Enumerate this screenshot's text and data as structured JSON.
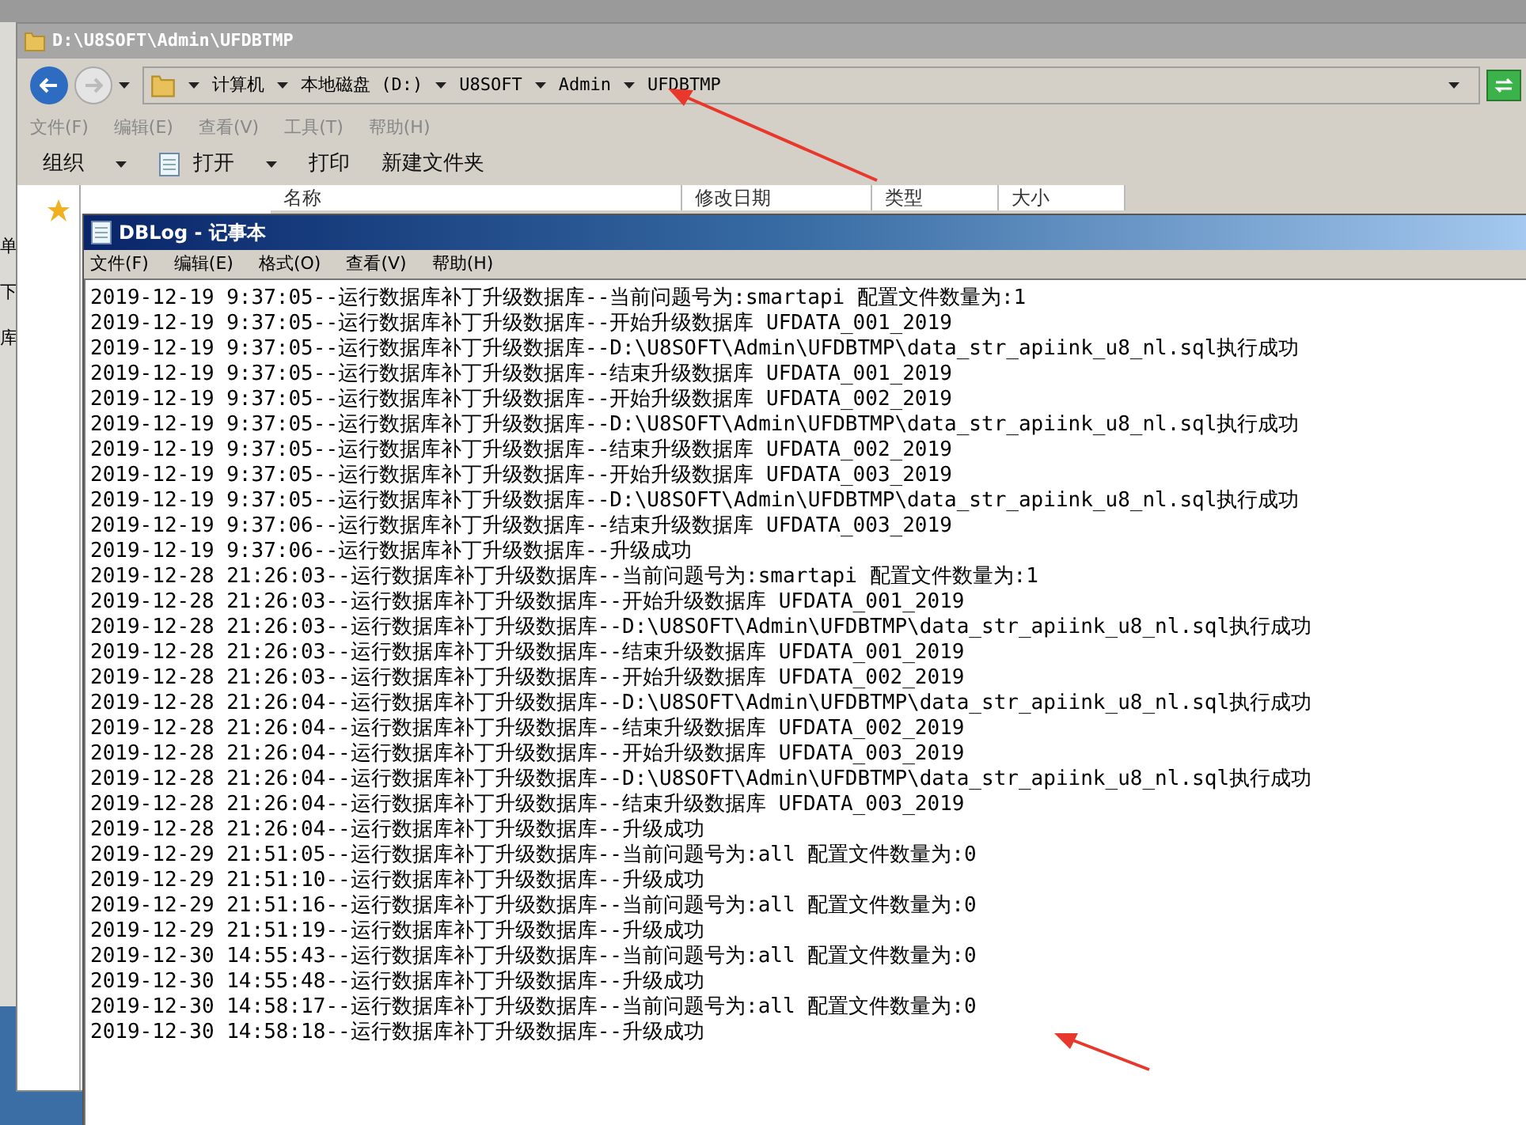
{
  "left_fragments": [
    "单",
    "下",
    "库"
  ],
  "explorer": {
    "title": "D:\\U8SOFT\\Admin\\UFDBTMP",
    "breadcrumb": [
      "计算机",
      "本地磁盘 (D:)",
      "U8SOFT",
      "Admin",
      "UFDBTMP"
    ],
    "menu": [
      "文件(F)",
      "编辑(E)",
      "查看(V)",
      "工具(T)",
      "帮助(H)"
    ],
    "toolbar": [
      {
        "label": "组织",
        "kind": "dropdown"
      },
      {
        "label": "打开",
        "kind": "icon-dropdown"
      },
      {
        "label": "打印",
        "kind": "plain"
      },
      {
        "label": "新建文件夹",
        "kind": "plain"
      }
    ],
    "columns": [
      "名称",
      "修改日期",
      "类型",
      "大小"
    ]
  },
  "notepad": {
    "title": "DBLog - 记事本",
    "menu": [
      "文件(F)",
      "编辑(E)",
      "格式(O)",
      "查看(V)",
      "帮助(H)"
    ],
    "lines": [
      "2019-12-19 9:37:05--运行数据库补丁升级数据库--当前问题号为:smartapi 配置文件数量为:1",
      "2019-12-19 9:37:05--运行数据库补丁升级数据库--开始升级数据库 UFDATA_001_2019",
      "2019-12-19 9:37:05--运行数据库补丁升级数据库--D:\\U8SOFT\\Admin\\UFDBTMP\\data_str_apiink_u8_nl.sql执行成功",
      "2019-12-19 9:37:05--运行数据库补丁升级数据库--结束升级数据库 UFDATA_001_2019",
      "2019-12-19 9:37:05--运行数据库补丁升级数据库--开始升级数据库 UFDATA_002_2019",
      "2019-12-19 9:37:05--运行数据库补丁升级数据库--D:\\U8SOFT\\Admin\\UFDBTMP\\data_str_apiink_u8_nl.sql执行成功",
      "2019-12-19 9:37:05--运行数据库补丁升级数据库--结束升级数据库 UFDATA_002_2019",
      "2019-12-19 9:37:05--运行数据库补丁升级数据库--开始升级数据库 UFDATA_003_2019",
      "2019-12-19 9:37:05--运行数据库补丁升级数据库--D:\\U8SOFT\\Admin\\UFDBTMP\\data_str_apiink_u8_nl.sql执行成功",
      "2019-12-19 9:37:06--运行数据库补丁升级数据库--结束升级数据库 UFDATA_003_2019",
      "2019-12-19 9:37:06--运行数据库补丁升级数据库--升级成功",
      "2019-12-28 21:26:03--运行数据库补丁升级数据库--当前问题号为:smartapi 配置文件数量为:1",
      "2019-12-28 21:26:03--运行数据库补丁升级数据库--开始升级数据库 UFDATA_001_2019",
      "2019-12-28 21:26:03--运行数据库补丁升级数据库--D:\\U8SOFT\\Admin\\UFDBTMP\\data_str_apiink_u8_nl.sql执行成功",
      "2019-12-28 21:26:03--运行数据库补丁升级数据库--结束升级数据库 UFDATA_001_2019",
      "2019-12-28 21:26:03--运行数据库补丁升级数据库--开始升级数据库 UFDATA_002_2019",
      "2019-12-28 21:26:04--运行数据库补丁升级数据库--D:\\U8SOFT\\Admin\\UFDBTMP\\data_str_apiink_u8_nl.sql执行成功",
      "2019-12-28 21:26:04--运行数据库补丁升级数据库--结束升级数据库 UFDATA_002_2019",
      "2019-12-28 21:26:04--运行数据库补丁升级数据库--开始升级数据库 UFDATA_003_2019",
      "2019-12-28 21:26:04--运行数据库补丁升级数据库--D:\\U8SOFT\\Admin\\UFDBTMP\\data_str_apiink_u8_nl.sql执行成功",
      "2019-12-28 21:26:04--运行数据库补丁升级数据库--结束升级数据库 UFDATA_003_2019",
      "2019-12-28 21:26:04--运行数据库补丁升级数据库--升级成功",
      "2019-12-29 21:51:05--运行数据库补丁升级数据库--当前问题号为:all 配置文件数量为:0",
      "2019-12-29 21:51:10--运行数据库补丁升级数据库--升级成功",
      "2019-12-29 21:51:16--运行数据库补丁升级数据库--当前问题号为:all 配置文件数量为:0",
      "2019-12-29 21:51:19--运行数据库补丁升级数据库--升级成功",
      "2019-12-30 14:55:43--运行数据库补丁升级数据库--当前问题号为:all 配置文件数量为:0",
      "2019-12-30 14:55:48--运行数据库补丁升级数据库--升级成功",
      "2019-12-30 14:58:17--运行数据库补丁升级数据库--当前问题号为:all 配置文件数量为:0",
      "2019-12-30 14:58:18--运行数据库补丁升级数据库--升级成功"
    ]
  }
}
